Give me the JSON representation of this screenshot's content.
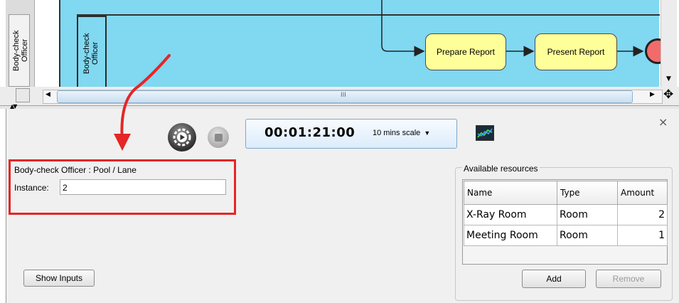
{
  "diagram": {
    "lane_name": "Body-check\nOfficer",
    "tasks": [
      "Prepare Report",
      "Present Report"
    ],
    "hscroll_grip": "III"
  },
  "simulation": {
    "elapsed_time": "00:01:21:00",
    "scale": "10 mins scale",
    "scale_arrow": "▼"
  },
  "properties": {
    "title": "Body-check Officer : Pool / Lane",
    "instance_label": "Instance:",
    "instance_value": "2"
  },
  "buttons": {
    "show_inputs": "Show Inputs",
    "add": "Add",
    "remove": "Remove",
    "close": "×"
  },
  "resources": {
    "title": "Available resources",
    "columns": [
      "Name",
      "Type",
      "Amount"
    ],
    "rows": [
      {
        "name": "X-Ray Room",
        "type": "Room",
        "amount": "2"
      },
      {
        "name": "Meeting Room",
        "type": "Room",
        "amount": "1"
      }
    ]
  },
  "colors": {
    "pool": "#80d8f1",
    "task_fill": "#ffff99",
    "end_event": "#f26b6b",
    "highlight": "#e52626",
    "annotation_arrow": "#e52626"
  },
  "icons": [
    "run-simulation-icon",
    "stop-icon",
    "chart-icon",
    "move-icon",
    "close-icon",
    "collapse-arrows-icon"
  ]
}
